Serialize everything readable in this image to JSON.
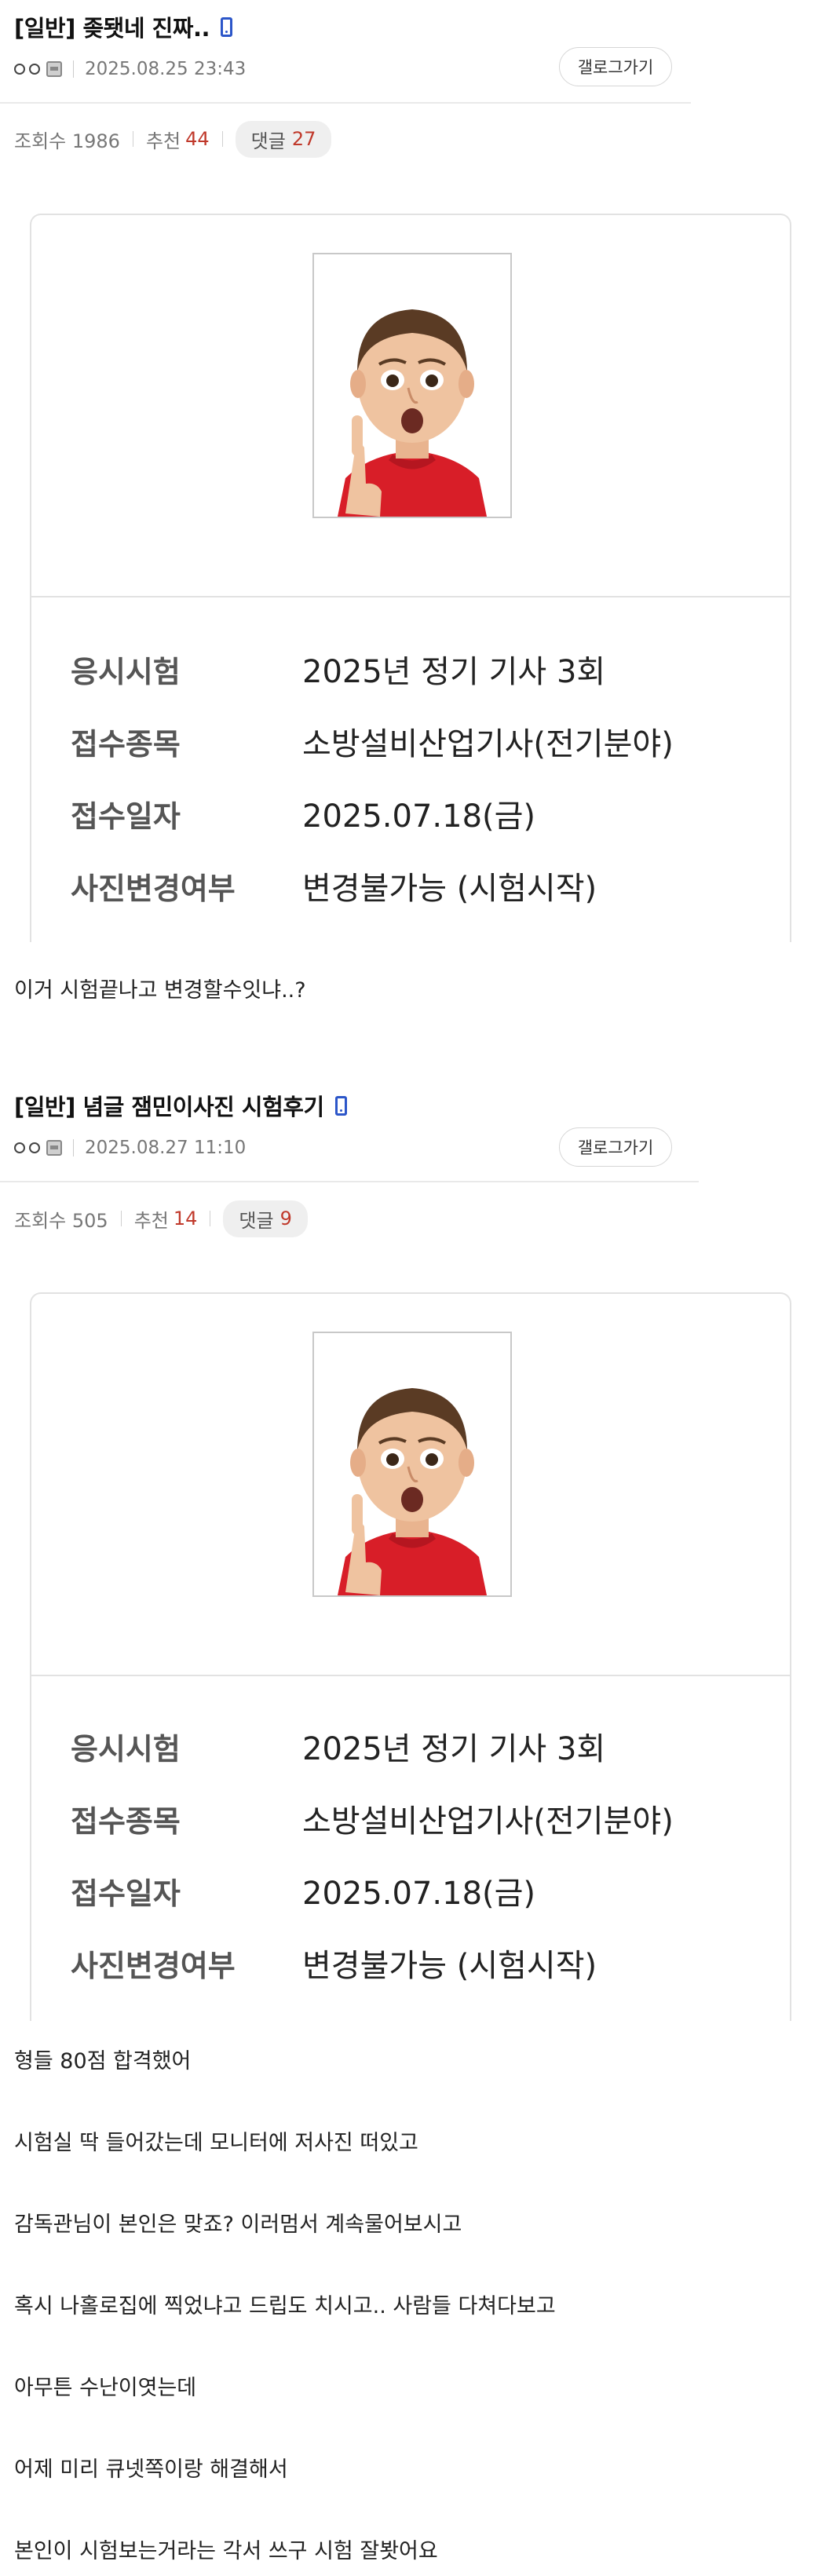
{
  "posts": [
    {
      "title": "[일반] 좆됏네 진짜..",
      "author_glyph": "ㅇㅇ",
      "date": "2025.08.25 23:43",
      "gallery_button": "갤로그가기",
      "views_label": "조회수 1986",
      "recommend_label": "추천",
      "recommend_count": "44",
      "comments_label": "댓글",
      "comments_count": "27",
      "card": {
        "rows": [
          {
            "label": "응시시험",
            "value": "2025년 정기 기사 3회"
          },
          {
            "label": "접수종목",
            "value": "소방설비산업기사(전기분야)"
          },
          {
            "label": "접수일자",
            "value": "2025.07.18(금)"
          },
          {
            "label": "사진변경여부",
            "value": "변경불가능 (시험시작)"
          }
        ]
      },
      "body": [
        "이거 시험끝나고 변경할수잇냐..?"
      ]
    },
    {
      "title": "[일반] 념글 잼민이사진 시험후기",
      "author_glyph": "ㅇㅇ",
      "date": "2025.08.27 11:10",
      "gallery_button": "갤로그가기",
      "views_label": "조회수 505",
      "recommend_label": "추천",
      "recommend_count": "14",
      "comments_label": "댓글",
      "comments_count": "9",
      "card": {
        "rows": [
          {
            "label": "응시시험",
            "value": "2025년 정기 기사 3회"
          },
          {
            "label": "접수종목",
            "value": "소방설비산업기사(전기분야)"
          },
          {
            "label": "접수일자",
            "value": "2025.07.18(금)"
          },
          {
            "label": "사진변경여부",
            "value": "변경불가능 (시험시작)"
          }
        ]
      },
      "body": [
        "형들 80점 합격했어",
        "시험실 딱 들어갔는데 모니터에 저사진 떠있고",
        "감독관님이 본인은 맞죠? 이러멈서 계속물어보시고",
        "혹시 나홀로집에 찍었냐고 드립도 치시고.. 사람들 다쳐다보고",
        "아무튼 수난이엿는데",
        "어제 미리 큐넷쪽이랑 해결해서",
        "본인이 시험보는거라는 각서 쓰구 시험 잘봣어요"
      ]
    }
  ],
  "colors": {
    "accent_red": "#c0392b",
    "phone_icon_blue": "#2c56c9"
  },
  "icons": [
    "mobile-phone-icon",
    "fixed-nick-icon"
  ]
}
